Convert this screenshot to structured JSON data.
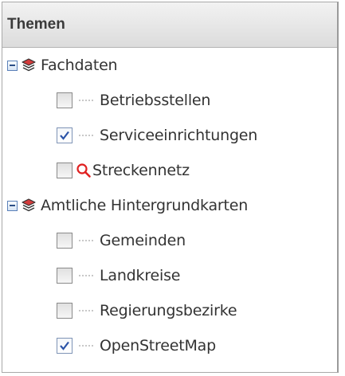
{
  "panel": {
    "title": "Themen"
  },
  "tree": {
    "groups": [
      {
        "label": "Fachdaten",
        "expanded": true,
        "items": [
          {
            "label": "Betriebsstellen",
            "checked": false,
            "icon": "dotted-connector"
          },
          {
            "label": "Serviceeinrichtungen",
            "checked": true,
            "icon": "dotted-connector"
          },
          {
            "label": "Streckennetz",
            "checked": false,
            "icon": "search-icon"
          }
        ]
      },
      {
        "label": "Amtliche Hintergrundkarten",
        "expanded": true,
        "items": [
          {
            "label": "Gemeinden",
            "checked": false,
            "icon": "dotted-connector"
          },
          {
            "label": "Landkreise",
            "checked": false,
            "icon": "dotted-connector"
          },
          {
            "label": "Regierungsbezirke",
            "checked": false,
            "icon": "dotted-connector"
          },
          {
            "label": "OpenStreetMap",
            "checked": true,
            "icon": "dotted-connector"
          }
        ]
      }
    ]
  },
  "colors": {
    "layers_icon_fill": "#d23b3b",
    "search_icon": "#e02020",
    "checkmark": "#2b54a8"
  }
}
